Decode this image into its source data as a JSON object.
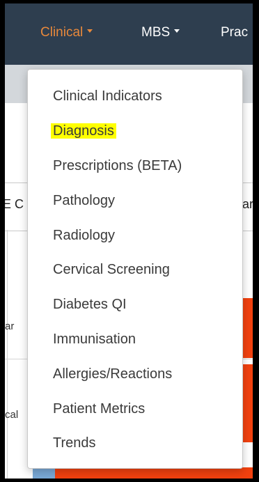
{
  "nav": {
    "items": [
      {
        "label": "Clinical"
      },
      {
        "label": "MBS"
      },
      {
        "label": "Prac"
      }
    ]
  },
  "background": {
    "fragment_e_c": "E C",
    "fragment_ar_right": "ar",
    "fragment_ar_left": "ar",
    "fragment_cal": "cal"
  },
  "dropdown": {
    "items": [
      {
        "label": "Clinical Indicators"
      },
      {
        "label": "Diagnosis",
        "highlighted": true
      },
      {
        "label": "Prescriptions (BETA)"
      },
      {
        "label": "Pathology"
      },
      {
        "label": "Radiology"
      },
      {
        "label": "Cervical Screening"
      },
      {
        "label": "Diabetes QI"
      },
      {
        "label": "Immunisation"
      },
      {
        "label": "Allergies/Reactions"
      },
      {
        "label": "Patient Metrics"
      },
      {
        "label": "Trends"
      }
    ]
  },
  "colors": {
    "navbar": "#2e3e4f",
    "active_nav": "#e9893b",
    "highlight": "#ffff00",
    "bar": "#f1410f"
  }
}
